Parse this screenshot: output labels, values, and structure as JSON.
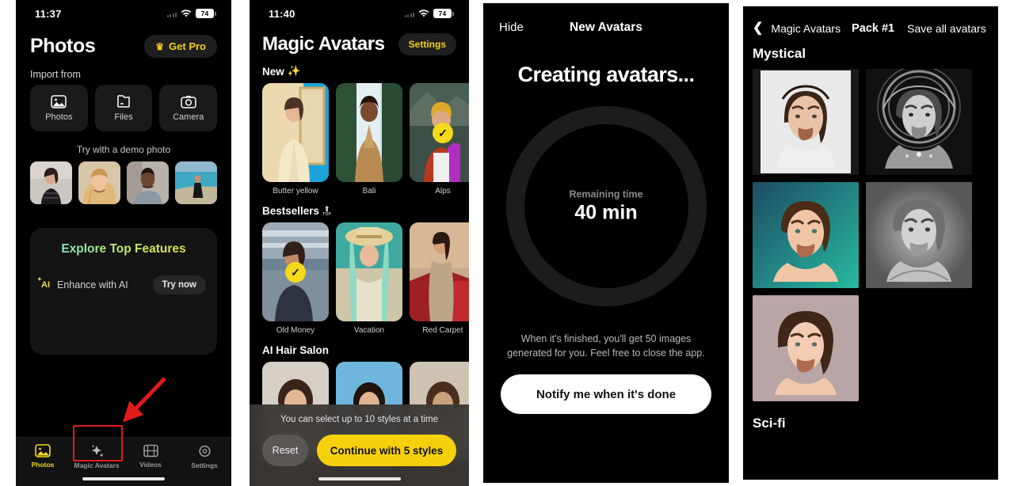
{
  "panel1": {
    "status": {
      "time": "11:37",
      "battery": "74",
      "wifi_icon": "wifi-icon",
      "signal_icon": "signal-dots-icon"
    },
    "title": "Photos",
    "get_pro": {
      "label": "Get Pro",
      "icon": "crown-icon"
    },
    "import_label": "Import from",
    "import_options": [
      {
        "label": "Photos",
        "icon": "image-icon"
      },
      {
        "label": "Files",
        "icon": "folder-icon"
      },
      {
        "label": "Camera",
        "icon": "camera-icon"
      }
    ],
    "demo_label": "Try with a demo photo",
    "demo_photos": [
      "demo-photo-1",
      "demo-photo-2",
      "demo-photo-3",
      "demo-photo-4"
    ],
    "features": {
      "title": "Explore Top Features",
      "row_badge": "AI",
      "row_label": "Enhance with AI",
      "row_button": "Try now"
    },
    "tabs": [
      {
        "label": "Photos",
        "icon": "image-icon",
        "active": true
      },
      {
        "label": "Magic Avatars",
        "icon": "sparkles-icon",
        "active": false
      },
      {
        "label": "Videos",
        "icon": "film-icon",
        "active": false
      },
      {
        "label": "Settings",
        "icon": "gear-icon",
        "active": false
      }
    ],
    "annotation": {
      "highlight_color": "#e01b1b",
      "target": "Magic Avatars"
    }
  },
  "panel2": {
    "status": {
      "time": "11:40",
      "battery": "74"
    },
    "title": "Magic Avatars",
    "settings_label": "Settings",
    "sections": [
      {
        "name": "New",
        "emoji": "✨",
        "badge": null,
        "tiles": [
          {
            "name": "Butter yellow",
            "selected": false
          },
          {
            "name": "Bali",
            "selected": false
          },
          {
            "name": "Alps",
            "selected": true
          }
        ]
      },
      {
        "name": "Bestsellers",
        "emoji": null,
        "badge": "TOP",
        "tiles": [
          {
            "name": "Old Money",
            "selected": true
          },
          {
            "name": "Vacation",
            "selected": false
          },
          {
            "name": "Red Carpet",
            "selected": false
          }
        ]
      },
      {
        "name": "AI Hair Salon",
        "emoji": null,
        "badge": null,
        "tiles": [
          {
            "name": "",
            "selected": false
          },
          {
            "name": "",
            "selected": false
          },
          {
            "name": "",
            "selected": false
          }
        ]
      }
    ],
    "sheet": {
      "note": "You can select up to 10 styles at a time",
      "reset_label": "Reset",
      "continue_label": "Continue with 5 styles"
    }
  },
  "panel3": {
    "hide_label": "Hide",
    "title": "New Avatars",
    "heading": "Creating avatars...",
    "ring": {
      "remaining_label": "Remaining time",
      "remaining_value": "40 min",
      "track_color": "#1c1c1e"
    },
    "note": "When it's finished, you'll get 50 images generated for you. Feel free to close the app.",
    "notify_label": "Notify me when it's done"
  },
  "panel4": {
    "back_label": "Magic Avatars",
    "back_icon": "chevron-left-icon",
    "pack_title": "Pack #1",
    "save_label": "Save all avatars",
    "section_title": "Mystical",
    "next_section_title": "Sci-fi",
    "avatars": [
      {
        "name": "avatar-mystical-1"
      },
      {
        "name": "avatar-mystical-2"
      },
      {
        "name": "avatar-mystical-3"
      },
      {
        "name": "avatar-mystical-4"
      },
      {
        "name": "avatar-mystical-5"
      }
    ]
  }
}
